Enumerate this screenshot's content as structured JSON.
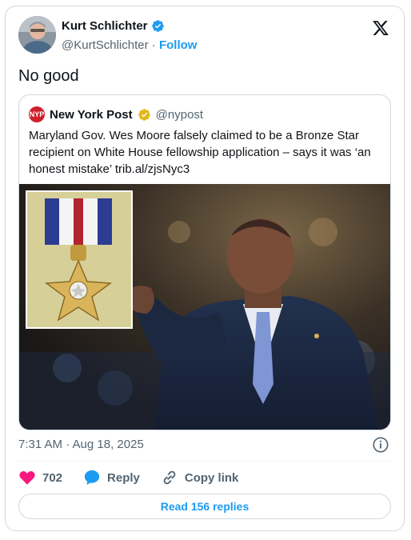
{
  "author": {
    "name": "Kurt Schlichter",
    "handle": "@KurtSchlichter",
    "separator": "·",
    "follow_label": "Follow"
  },
  "tweet": {
    "text": "No good",
    "timestamp": "7:31 AM · Aug 18, 2025"
  },
  "quoted": {
    "name": "New York Post",
    "handle": "@nypost",
    "logo_text": "NYP",
    "text": "Maryland Gov. Wes Moore falsely claimed to be a Bronze Star recipient on White House fellowship application – says it was ‘an honest mistake’ trib.al/zjsNyc3"
  },
  "actions": {
    "likes": "702",
    "reply_label": "Reply",
    "copy_label": "Copy link"
  },
  "read_replies_label": "Read 156 replies",
  "colors": {
    "accent": "#1d9bf0",
    "like": "#f91880",
    "gold_badge": "#e2b719",
    "nyp_red": "#d01f2c"
  }
}
